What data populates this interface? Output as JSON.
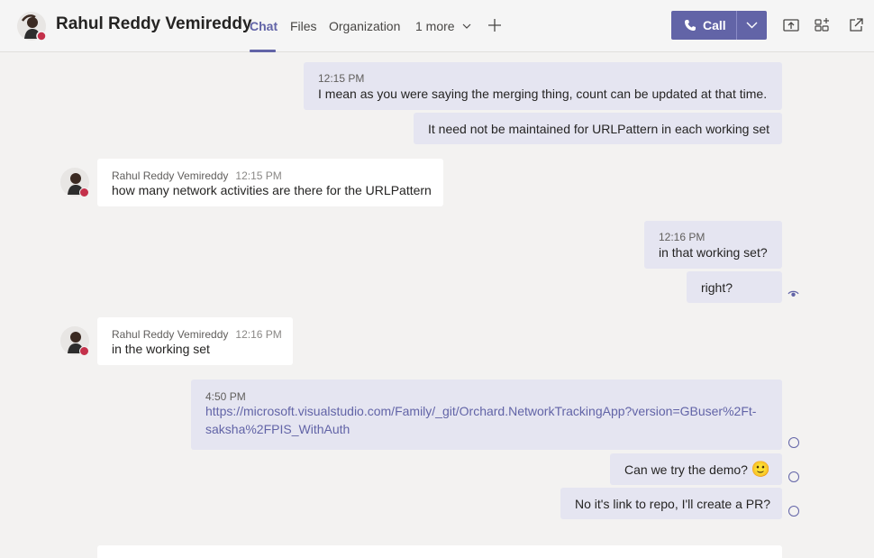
{
  "header": {
    "title": "Rahul Reddy Vemireddy",
    "tabs": [
      {
        "label": "Chat"
      },
      {
        "label": "Files"
      },
      {
        "label": "Organization"
      },
      {
        "label": "1 more"
      }
    ],
    "call_label": "Call",
    "accent": "#6264a7"
  },
  "messages": [
    {
      "time": "12:15 PM",
      "text": "I mean as you were saying the merging thing, count can be updated at that time."
    },
    {
      "text": "It need not be maintained for URLPattern in each working set"
    },
    {
      "sender": "Rahul Reddy Vemireddy",
      "time": "12:15 PM",
      "text": "how many network activities are there for the URLPattern"
    },
    {
      "time": "12:16 PM",
      "text": "in that working set?"
    },
    {
      "text": "right?"
    },
    {
      "sender": "Rahul Reddy Vemireddy",
      "time": "12:16 PM",
      "text": "in the working set"
    },
    {
      "time": "4:50 PM",
      "link_line1": "https://microsoft.visualstudio.com/Family/_git/Orchard.NetworkTrackingApp?version=GBuser%2Ft-",
      "link_line2": "saksha%2FPIS_WithAuth"
    },
    {
      "text": "Can we try the demo?",
      "emoji": "🙂"
    },
    {
      "text": "No it's link to repo, I'll create a PR?"
    }
  ],
  "icons": {
    "phone": "phone-icon",
    "share": "share-screen-icon",
    "add_people": "add-people-icon",
    "popout": "pop-out-icon",
    "seen": "eye-icon",
    "sent": "sent-receipt-icon"
  },
  "status_color": "#c4314b"
}
